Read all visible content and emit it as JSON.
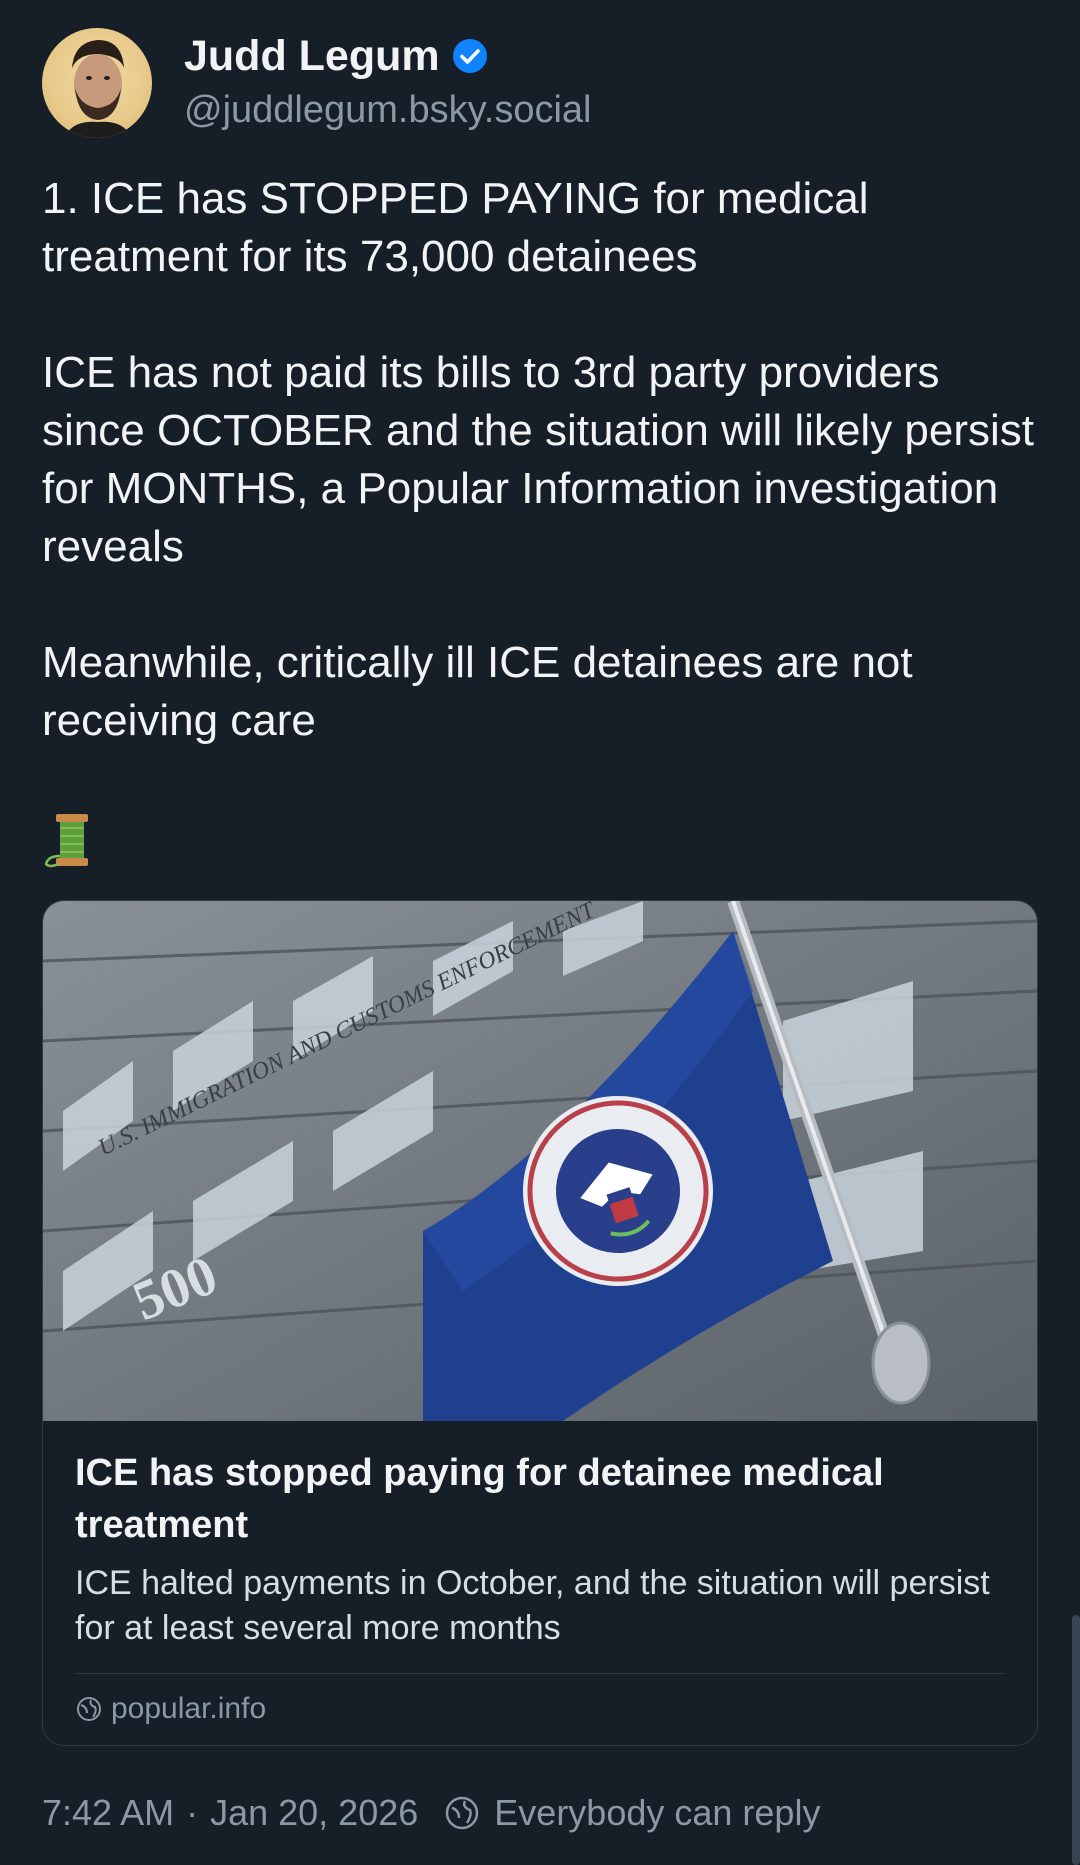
{
  "author": {
    "display_name": "Judd Legum",
    "handle": "@juddlegum.bsky.social",
    "verified": true,
    "avatar_icon": "profile-photo"
  },
  "post": {
    "paragraphs": [
      "1. ICE has STOPPED PAYING for medical treatment for its 73,000 detainees",
      "ICE has not paid its bills to 3rd party providers since OCTOBER and the situation will likely persist for MONTHS, a Popular Information investigation reveals",
      "Meanwhile, critically ill ICE detainees are not receiving care"
    ],
    "thread_emoji_icon": "spool-of-thread-icon"
  },
  "link_card": {
    "image_building_letters": "U.S. IMMIGRATION AND CUSTOMS ENFORCEMENT",
    "image_number": "500",
    "title": "ICE has stopped paying for detainee medical treatment",
    "description": "ICE halted payments in October, and the situation will persist for at least several more months",
    "domain": "popular.info"
  },
  "footer": {
    "time": "7:42 AM",
    "separator": "·",
    "date": "Jan 20, 2026",
    "reply_setting": "Everybody can reply"
  },
  "colors": {
    "background": "#161e27",
    "text": "#f1f3f5",
    "muted": "#8b98a5",
    "verified": "#1083fe",
    "flag": "#1f3f8f"
  }
}
